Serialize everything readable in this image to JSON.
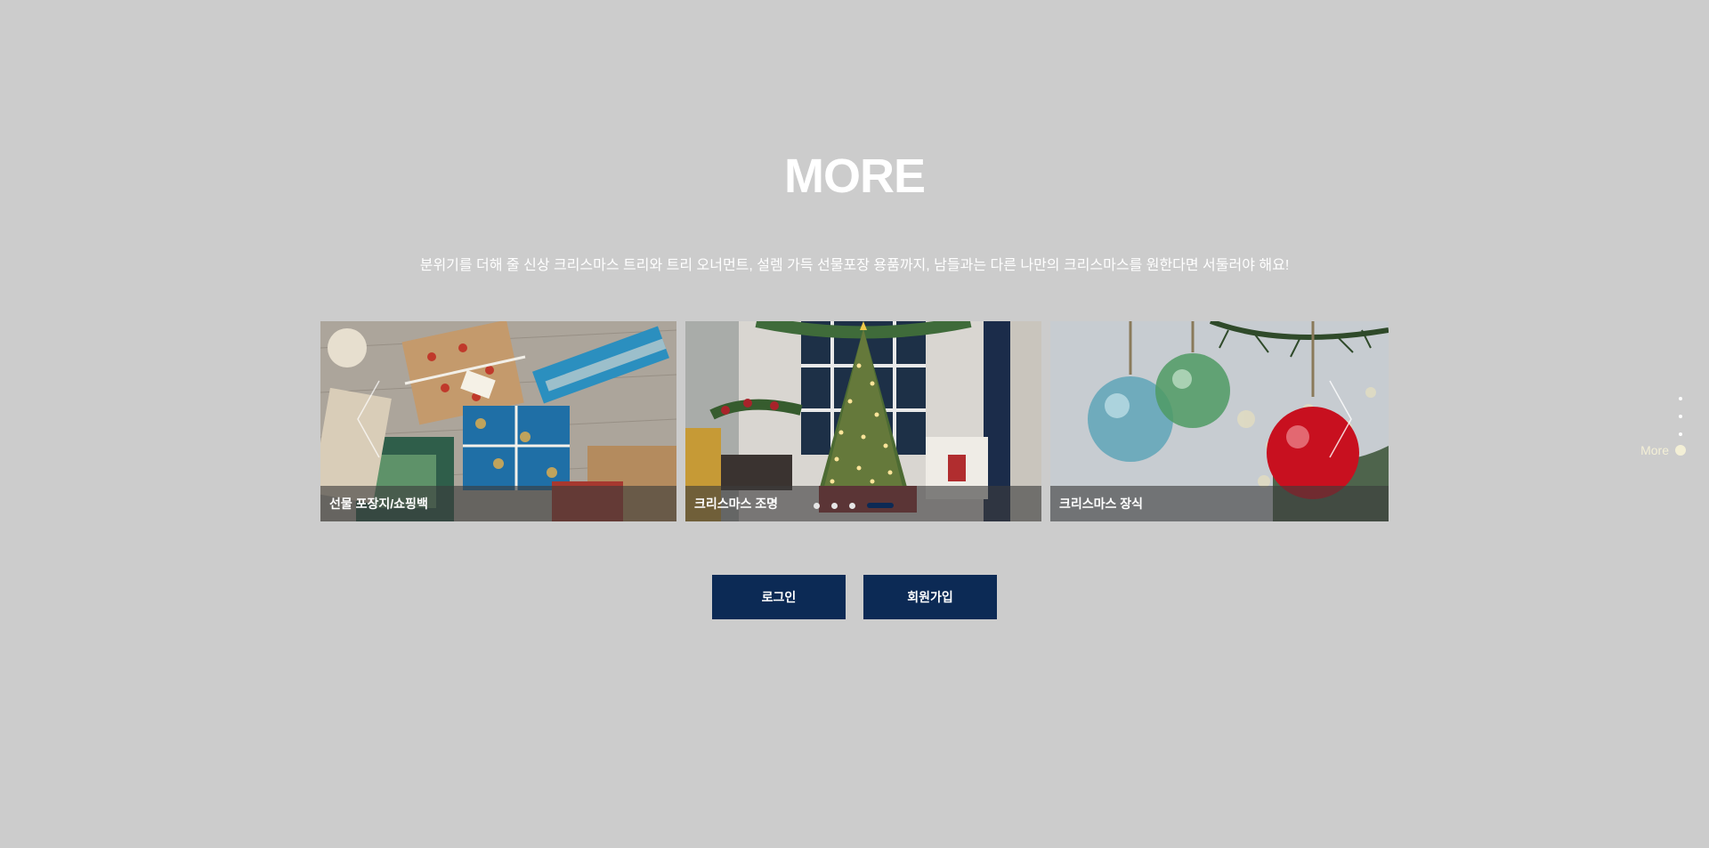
{
  "section": {
    "title": "MORE",
    "description": "분위기를 더해 줄 신상 크리스마스 트리와 트리 오너먼트, 설렘 가득 선물포장 용품까지, 남들과는 다른 나만의 크리스마스를 원한다면 서둘러야 해요!"
  },
  "cards": [
    {
      "label": "선물 포장지/쇼핑백"
    },
    {
      "label": "크리스마스 조명"
    },
    {
      "label": "크리스마스 장식"
    }
  ],
  "pagination": {
    "total": 4,
    "active_index": 4
  },
  "buttons": {
    "login": "로그인",
    "join": "회원가입"
  },
  "sidenav": {
    "active_label": "More"
  }
}
